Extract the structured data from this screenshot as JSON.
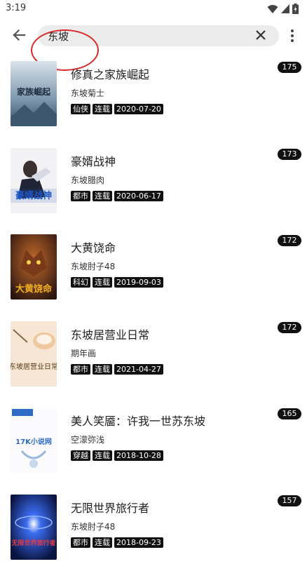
{
  "status": {
    "time": "3:19"
  },
  "search": {
    "value": "东坡"
  },
  "icons": {
    "back": "arrow-left-icon",
    "clear": "close-icon",
    "menu": "more-vert-icon",
    "wifi": "wifi-icon",
    "signal": "cell-signal-icon",
    "battery": "battery-charging-icon"
  },
  "results": [
    {
      "title": "修真之家族崛起",
      "author": "东坡菊士",
      "tags": [
        "仙侠",
        "连载",
        "2020-07-20"
      ],
      "count": "175",
      "cover_text": "家族崛起"
    },
    {
      "title": "豪婿战神",
      "author": "东坡腊肉",
      "tags": [
        "都市",
        "连载",
        "2020-06-17"
      ],
      "count": "173",
      "cover_text": "豪婿战神"
    },
    {
      "title": "大黄饶命",
      "author": "东坡肘子48",
      "tags": [
        "科幻",
        "连载",
        "2019-09-03"
      ],
      "count": "172",
      "cover_text": "大黄饶命"
    },
    {
      "title": "东坡居营业日常",
      "author": "期年画",
      "tags": [
        "都市",
        "连载",
        "2021-04-27"
      ],
      "count": "172",
      "cover_text": "东坡居营业日常"
    },
    {
      "title": "美人笑靥：许我一世苏东坡",
      "author": "空濛弥浅",
      "tags": [
        "穿越",
        "连载",
        "2018-10-28"
      ],
      "count": "165",
      "cover_text": "17K小说网"
    },
    {
      "title": "无限世界旅行者",
      "author": "东坡肘子48",
      "tags": [
        "都市",
        "连载",
        "2018-09-23"
      ],
      "count": "157",
      "cover_text": "无限世界旅行者"
    }
  ]
}
